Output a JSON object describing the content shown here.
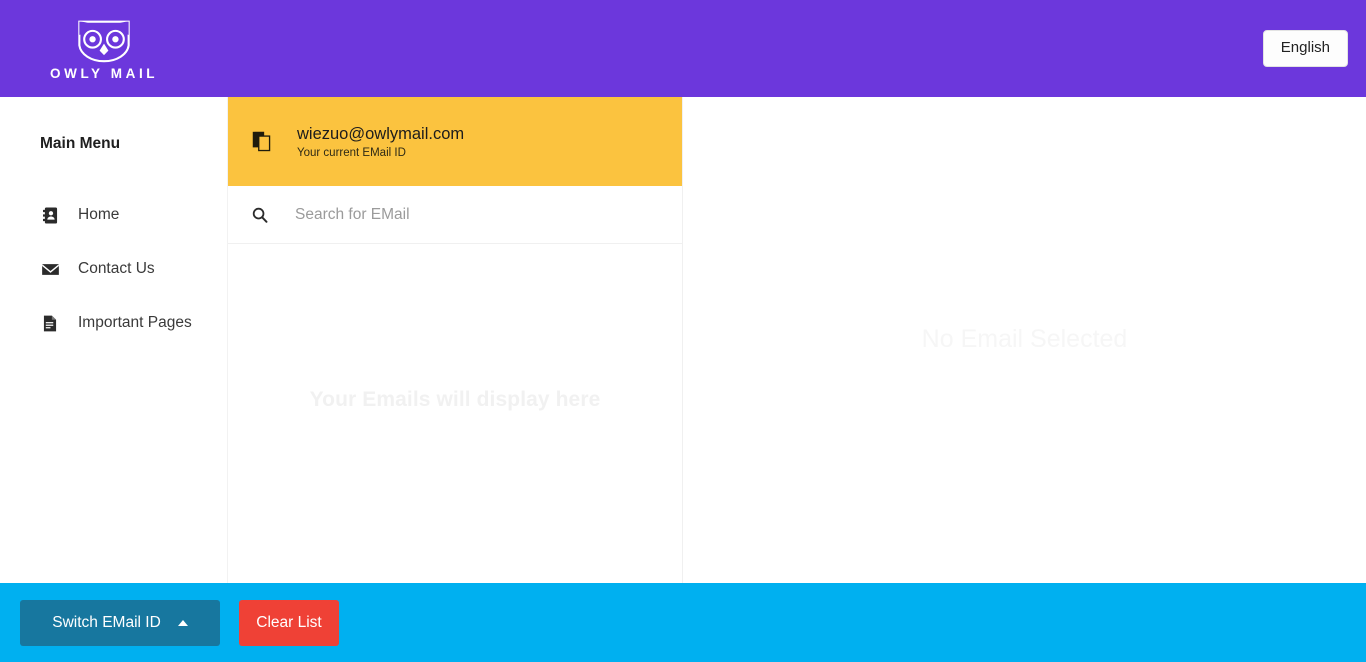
{
  "header": {
    "brand_name": "OWLY MAIL",
    "logo_icon": "owl-icon",
    "language_label": "English"
  },
  "sidebar": {
    "title": "Main Menu",
    "items": [
      {
        "label": "Home",
        "icon": "address-book-icon"
      },
      {
        "label": "Contact Us",
        "icon": "envelope-icon"
      },
      {
        "label": "Important Pages",
        "icon": "document-icon"
      }
    ]
  },
  "mailbox": {
    "current_email": "wiezuo@owlymail.com",
    "current_email_caption": "Your current EMail ID",
    "copy_icon": "copy-icon",
    "search_icon": "search-icon",
    "search_value": "",
    "search_placeholder": "Search for EMail",
    "empty_list_text": "Your Emails will display here"
  },
  "reading_pane": {
    "empty_text": "No Email Selected"
  },
  "footer": {
    "switch_label": "Switch EMail ID",
    "switch_caret_icon": "caret-up-icon",
    "clear_label": "Clear List"
  },
  "colors": {
    "header_purple": "#6c37dc",
    "mailid_amber": "#fbc33f",
    "footer_cyan": "#00b0f0",
    "switch_button": "#17779f",
    "clear_button": "#ef4136"
  }
}
